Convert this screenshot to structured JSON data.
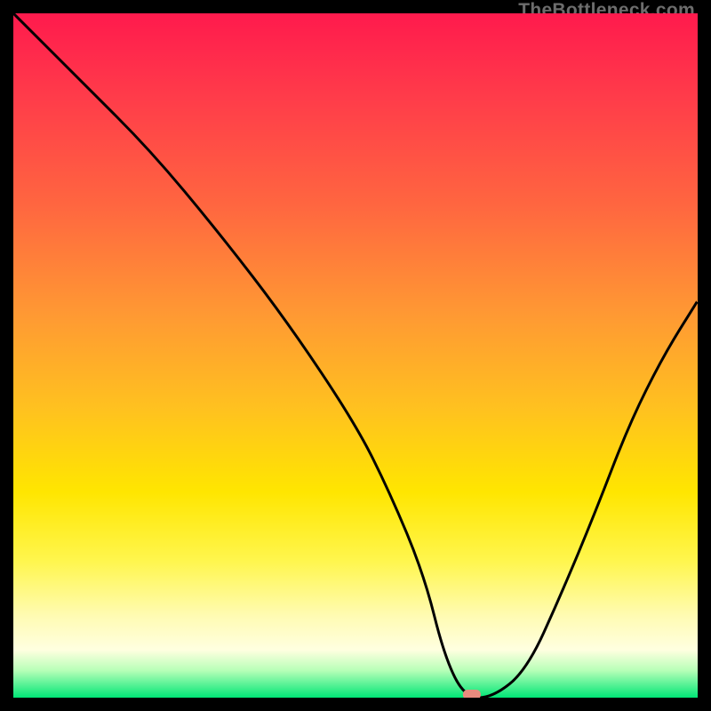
{
  "watermark": "TheBottleneck.com",
  "colors": {
    "top": "#ff1a4d",
    "mid": "#ffe600",
    "bottom": "#00e676",
    "curve": "#000000",
    "marker": "#e98b7e",
    "frame": "#000000"
  },
  "chart_data": {
    "type": "line",
    "title": "",
    "xlabel": "",
    "ylabel": "",
    "xlim": [
      0,
      100
    ],
    "ylim": [
      0,
      100
    ],
    "x": [
      0,
      10,
      20,
      30,
      40,
      50,
      55,
      60,
      63,
      66,
      70,
      75,
      80,
      85,
      90,
      95,
      100
    ],
    "values": [
      100,
      90,
      80,
      68,
      55,
      40,
      30,
      18,
      6,
      0,
      0,
      4,
      15,
      27,
      40,
      50,
      58
    ],
    "optimal_x": 67,
    "optimal_y": 0,
    "annotations": []
  }
}
